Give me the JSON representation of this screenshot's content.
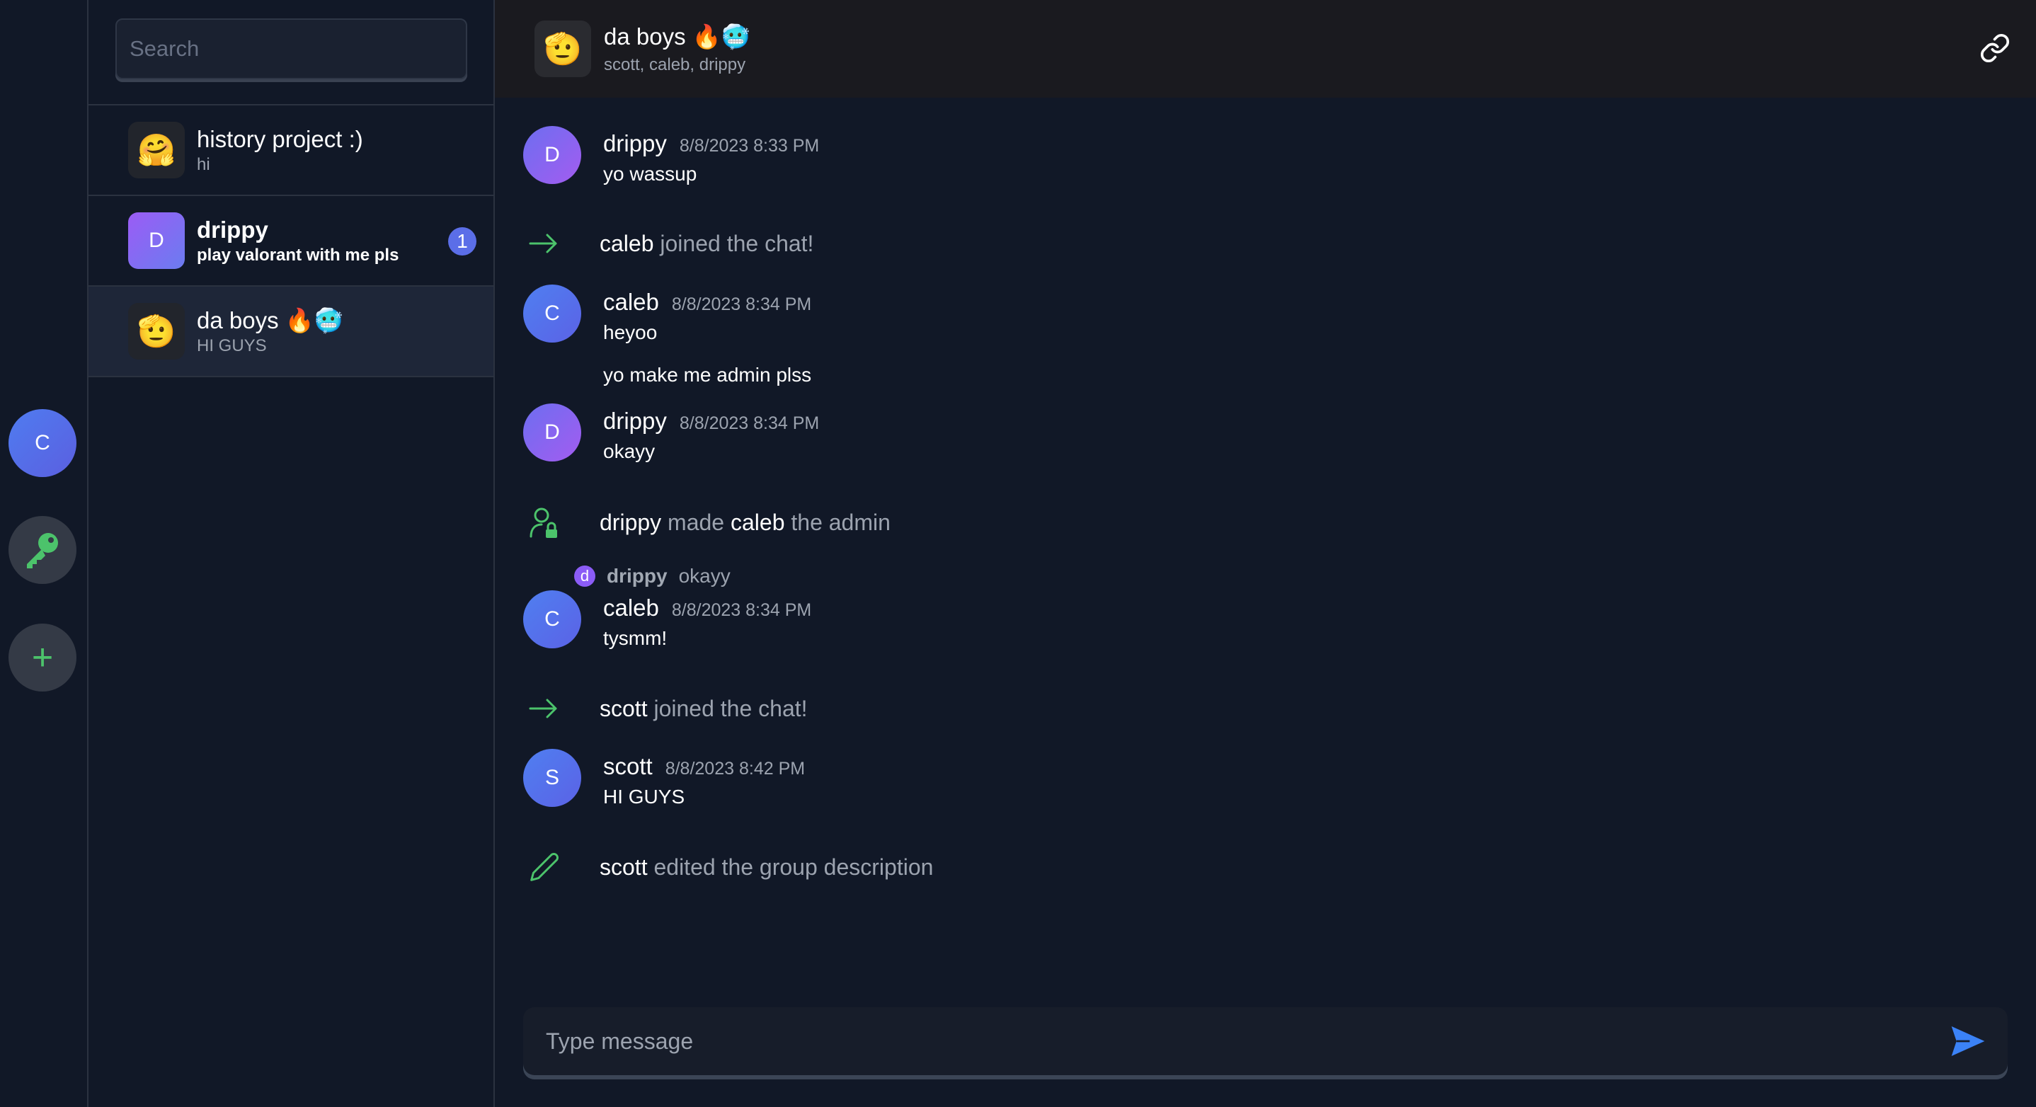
{
  "rail": {
    "avatar_letter": "C",
    "add_label": "+"
  },
  "sidebar": {
    "search_placeholder": "Search",
    "conversations": [
      {
        "name": "history project :)",
        "preview": "hi",
        "avatar": "🤗",
        "unread": null
      },
      {
        "name": "drippy",
        "preview": "play valorant with me pls",
        "avatar": "D",
        "unread": "1"
      },
      {
        "name": "da boys 🔥🥶",
        "preview": "HI GUYS",
        "avatar": "🫡"
      }
    ]
  },
  "header": {
    "name": "da boys 🔥🥶",
    "members": "scott, caleb, drippy",
    "avatar": "🫡"
  },
  "messages": [
    {
      "author": "drippy",
      "time": "8/8/2023 8:33 PM",
      "text": "yo wassup",
      "avatar": "D"
    },
    {
      "author": "caleb",
      "time": "8/8/2023 8:34 PM",
      "text": "heyoo",
      "text2": "yo make me admin plss",
      "avatar": "C"
    },
    {
      "author": "drippy",
      "time": "8/8/2023 8:34 PM",
      "text": "okayy",
      "avatar": "D"
    },
    {
      "author": "caleb",
      "time": "8/8/2023 8:34 PM",
      "text": "tysmm!",
      "avatar": "C",
      "reply": {
        "avatar": "d",
        "author": "drippy",
        "text": "okayy"
      }
    },
    {
      "author": "scott",
      "time": "8/8/2023 8:42 PM",
      "text": "HI GUYS",
      "avatar": "S"
    }
  ],
  "system_events": [
    {
      "who": "caleb",
      "text": " joined the chat!"
    },
    {
      "who": "drippy",
      "text": " made ",
      "who2": "caleb",
      "text2": " the admin"
    },
    {
      "who": "scott",
      "text": " joined the chat!"
    },
    {
      "who": "scott",
      "text": " edited the group description"
    }
  ],
  "composer": {
    "placeholder": "Type message"
  },
  "colors": {
    "background": "#111827",
    "header": "#1a1a1f",
    "accent_green": "#4cc36b",
    "send_blue": "#3b82f6",
    "badge": "#5b6ee8"
  }
}
